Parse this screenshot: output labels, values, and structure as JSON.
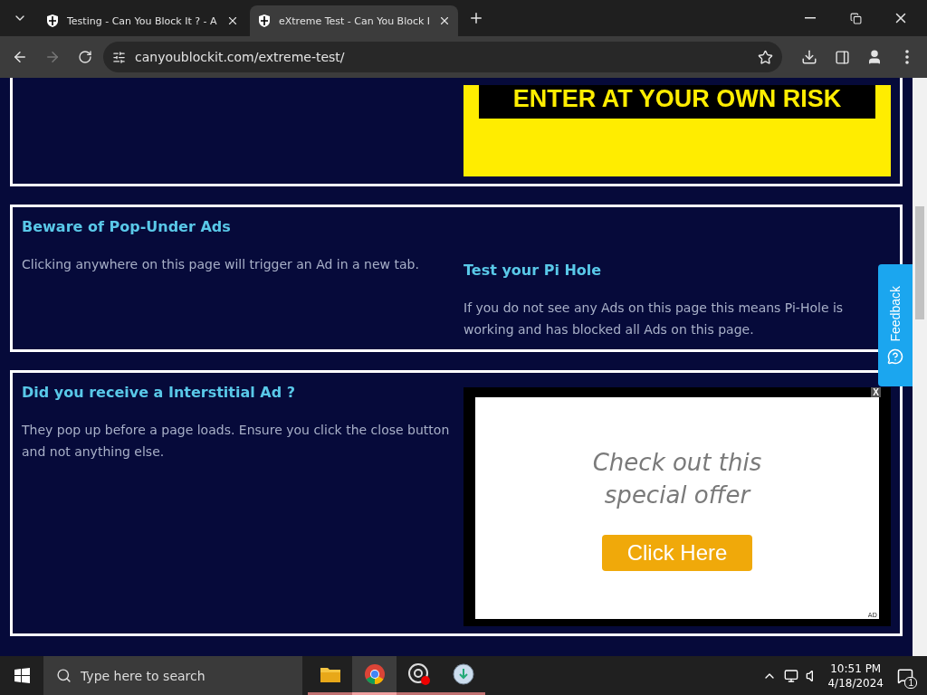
{
  "browser": {
    "tabs": [
      {
        "title": "Testing - Can You Block It ? - A",
        "selected": false
      },
      {
        "title": "eXtreme Test - Can You Block I",
        "selected": true
      }
    ],
    "url": "canyoublockit.com/extreme-test/"
  },
  "page": {
    "banner": {
      "text": "ENTER AT YOUR OWN RISK"
    },
    "sections": [
      {
        "kind": "text",
        "title": "Beware of Pop-Under Ads",
        "body": "Clicking anywhere on this page will trigger an Ad in a new tab.",
        "side_title": "Test your Pi Hole",
        "side_body": "If you do not see any Ads on this page this means Pi-Hole is working and has blocked all Ads on this page."
      },
      {
        "kind": "ad",
        "title": "Did you receive a Interstitial Ad ?",
        "body": "They pop up before a page loads. Ensure you click the close button and not anything else.",
        "ad": {
          "close": "X",
          "headline": "Check out this special offer",
          "button": "Click Here",
          "tag": "AD"
        }
      }
    ],
    "feedback": "Feedback"
  },
  "taskbar": {
    "search_placeholder": "Type here to search",
    "apps": [
      {
        "kind": "folder",
        "selected": false
      },
      {
        "kind": "chrome",
        "selected": true
      },
      {
        "kind": "obs",
        "selected": false
      },
      {
        "kind": "globe",
        "selected": false
      }
    ],
    "time": "10:51 PM",
    "date": "4/18/2024",
    "notifications": "1"
  }
}
